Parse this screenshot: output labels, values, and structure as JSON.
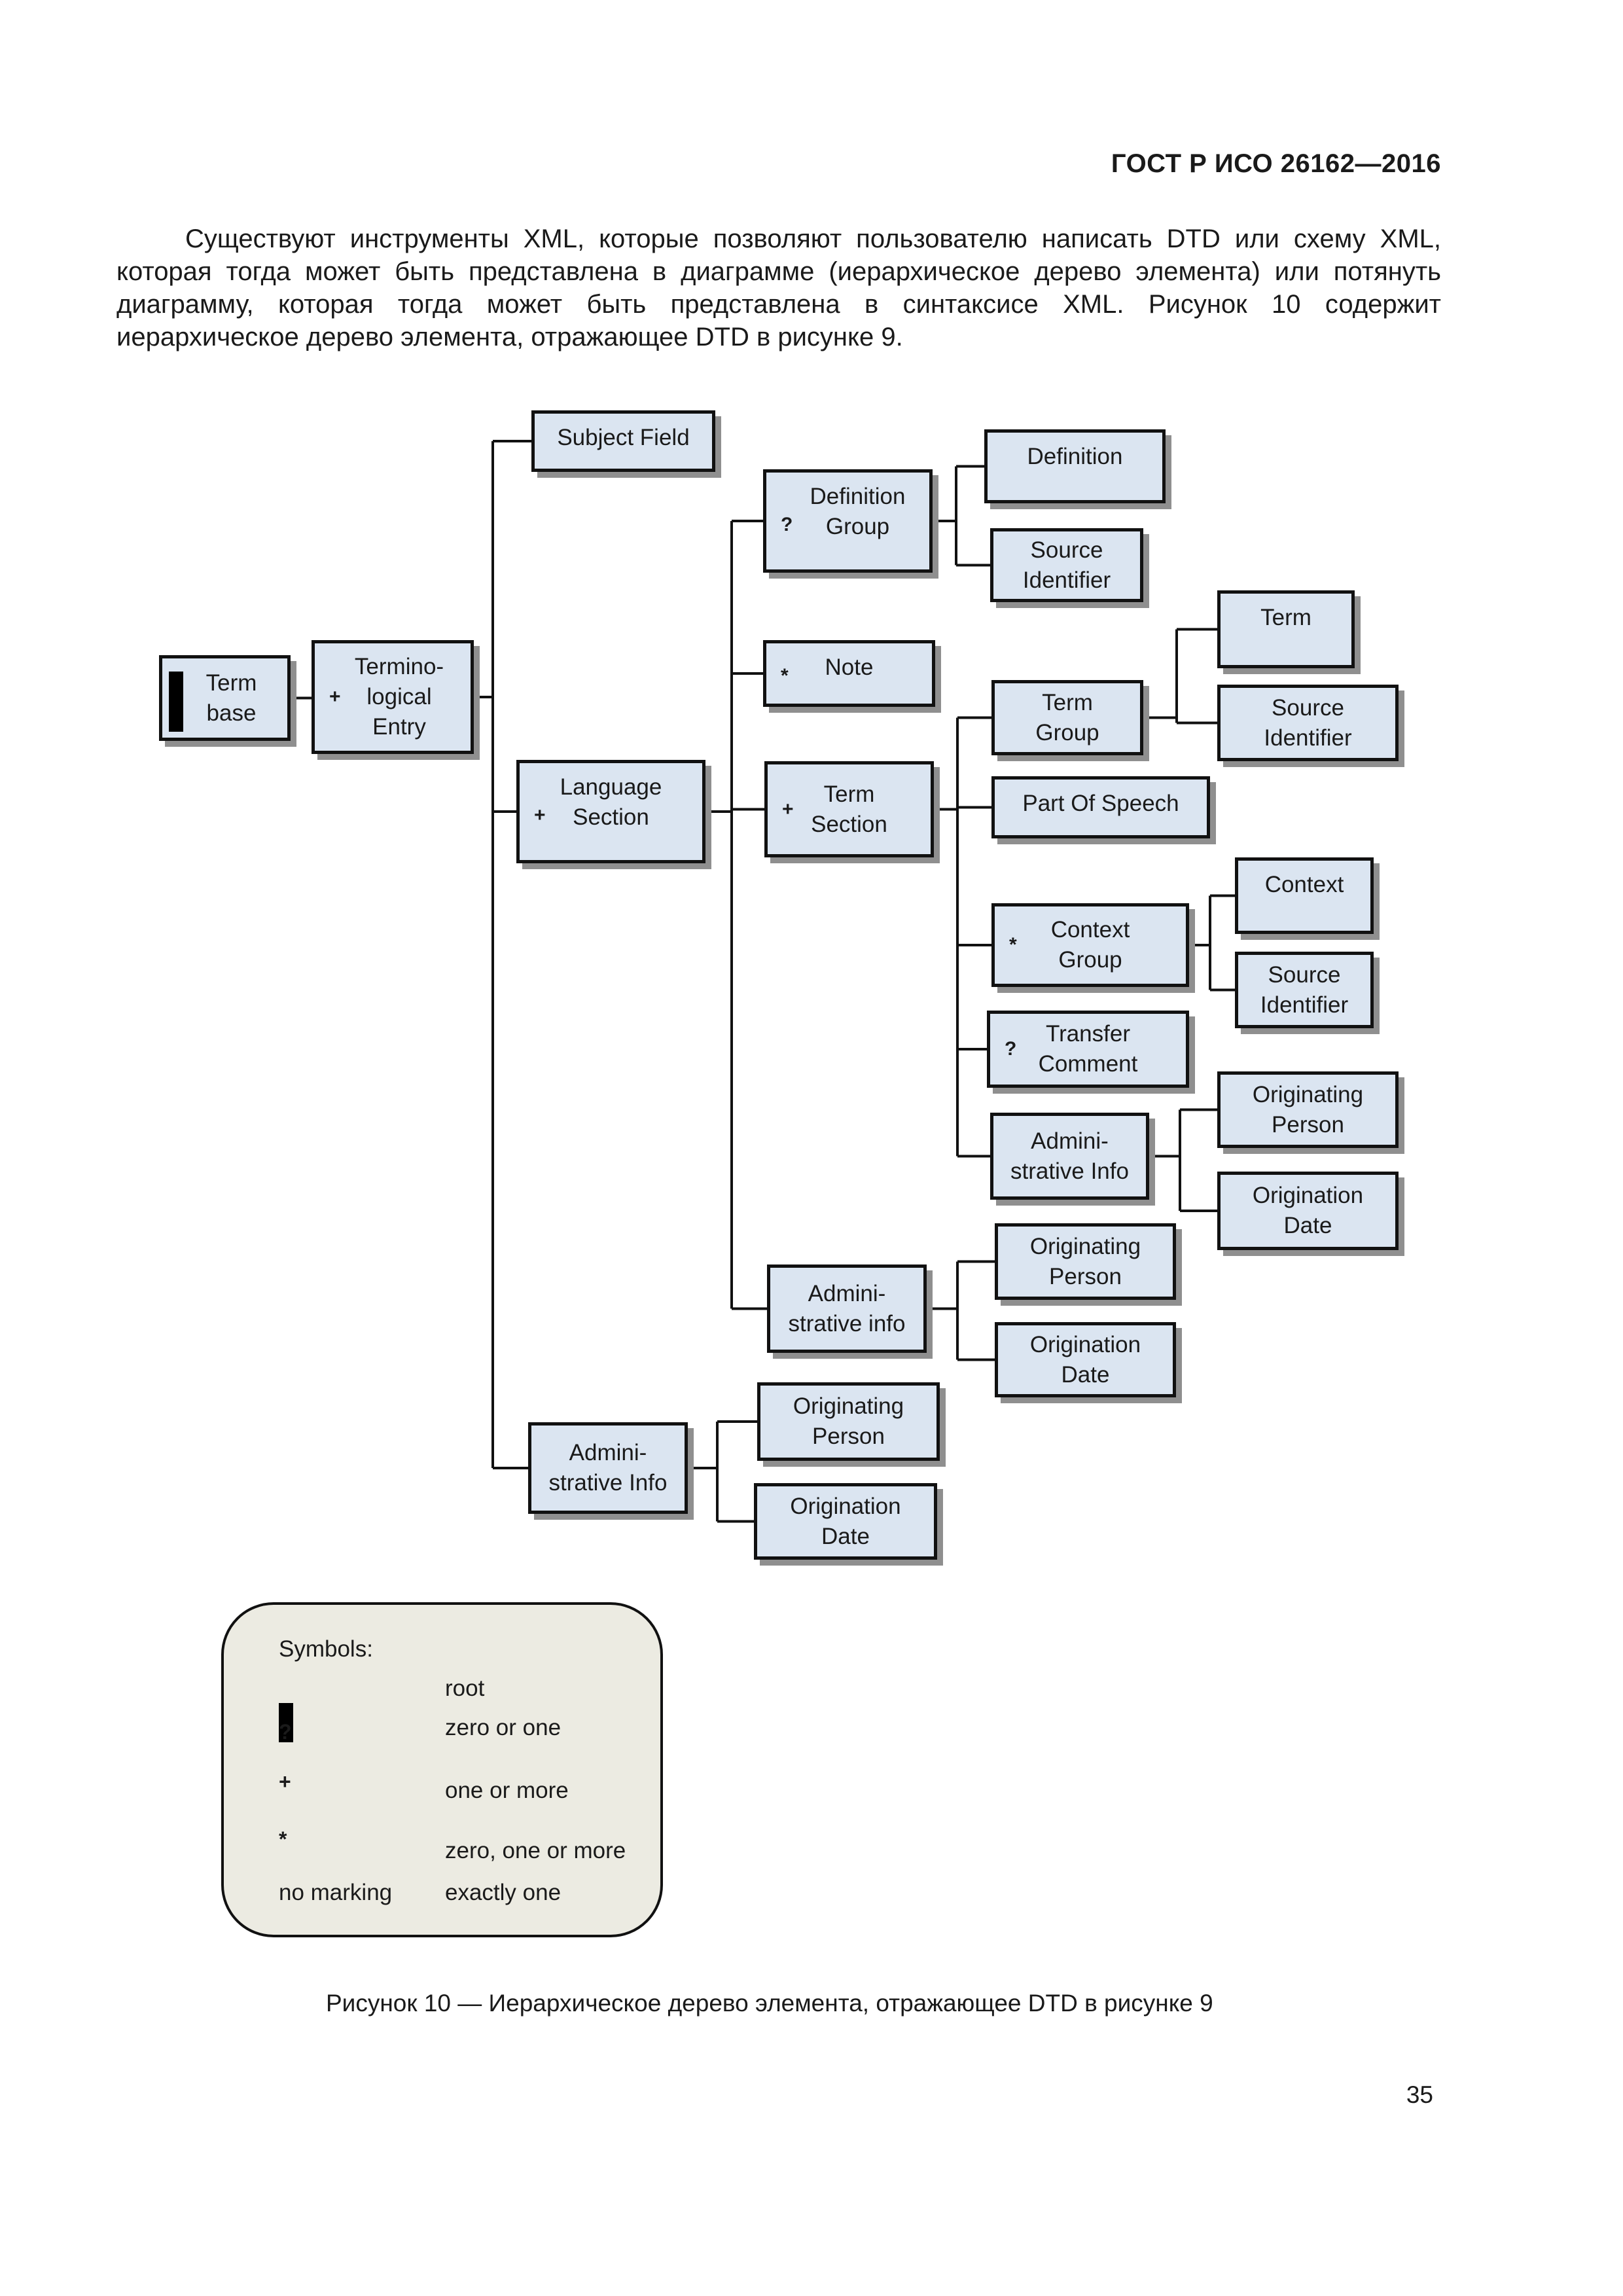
{
  "header": {
    "standard_id": "ГОСТ Р ИСО 26162—2016"
  },
  "intro_paragraph": "Существуют инструменты XML, которые позволяют пользователю написать DTD или схему XML, которая тогда может быть представлена в диаграмме (иерархическое дерево элемента) или потянуть диаграмму, которая тогда может быть представлена в синтаксисе XML. Рисунок 10 содержит иерархическое дерево элемента, отражающее DTD в рисунке 9.",
  "diagram": {
    "colors": {
      "box_fill": "#dbe5f1",
      "box_border": "#111111",
      "shadow": "#8f8f8f",
      "legend_fill": "#ecebe2"
    },
    "nodes": {
      "term_base": {
        "label": "Term\nbase",
        "marker": "root"
      },
      "terminological_entry": {
        "label": "Termino-\nlogical\nEntry",
        "marker": "+"
      },
      "subject_field": {
        "label": "Subject Field",
        "marker": ""
      },
      "language_section": {
        "label": "Language\nSection",
        "marker": "+"
      },
      "admin_info_entry": {
        "label": "Admini-\nstrative Info",
        "marker": ""
      },
      "definition_group": {
        "label": "Definition\nGroup",
        "marker": "?"
      },
      "note": {
        "label": "Note",
        "marker": "*"
      },
      "term_section": {
        "label": "Term\nSection",
        "marker": "+"
      },
      "admin_info_lang": {
        "label": "Admini-\nstrative info",
        "marker": ""
      },
      "definition": {
        "label": "Definition",
        "marker": ""
      },
      "source_identifier_def": {
        "label": "Source\nIdentifier",
        "marker": ""
      },
      "term_group": {
        "label": "Term\nGroup",
        "marker": ""
      },
      "part_of_speech": {
        "label": "Part Of Speech",
        "marker": ""
      },
      "context_group": {
        "label": "Context\nGroup",
        "marker": "*"
      },
      "transfer_comment": {
        "label": "Transfer\nComment",
        "marker": "?"
      },
      "admin_info_term": {
        "label": "Admini-\nstrative Info",
        "marker": ""
      },
      "term": {
        "label": "Term",
        "marker": ""
      },
      "source_identifier_term": {
        "label": "Source\nIdentifier",
        "marker": ""
      },
      "context": {
        "label": "Context",
        "marker": ""
      },
      "source_identifier_context": {
        "label": "Source\nIdentifier",
        "marker": ""
      },
      "originating_person_term": {
        "label": "Originating\nPerson",
        "marker": ""
      },
      "origination_date_term": {
        "label": "Origination\nDate",
        "marker": ""
      },
      "originating_person_lang": {
        "label": "Originating\nPerson",
        "marker": ""
      },
      "origination_date_lang": {
        "label": "Origination\nDate",
        "marker": ""
      },
      "originating_person_entry": {
        "label": "Originating\nPerson",
        "marker": ""
      },
      "origination_date_entry": {
        "label": "Origination\nDate",
        "marker": ""
      }
    },
    "edges": [
      [
        "term_base",
        "terminological_entry"
      ],
      [
        "terminological_entry",
        "subject_field"
      ],
      [
        "terminological_entry",
        "language_section"
      ],
      [
        "terminological_entry",
        "admin_info_entry"
      ],
      [
        "language_section",
        "definition_group"
      ],
      [
        "language_section",
        "note"
      ],
      [
        "language_section",
        "term_section"
      ],
      [
        "language_section",
        "admin_info_lang"
      ],
      [
        "definition_group",
        "definition"
      ],
      [
        "definition_group",
        "source_identifier_def"
      ],
      [
        "term_section",
        "term_group"
      ],
      [
        "term_section",
        "part_of_speech"
      ],
      [
        "term_section",
        "context_group"
      ],
      [
        "term_section",
        "transfer_comment"
      ],
      [
        "term_section",
        "admin_info_term"
      ],
      [
        "term_group",
        "term"
      ],
      [
        "term_group",
        "source_identifier_term"
      ],
      [
        "context_group",
        "context"
      ],
      [
        "context_group",
        "source_identifier_context"
      ],
      [
        "admin_info_term",
        "originating_person_term"
      ],
      [
        "admin_info_term",
        "origination_date_term"
      ],
      [
        "admin_info_lang",
        "originating_person_lang"
      ],
      [
        "admin_info_lang",
        "origination_date_lang"
      ],
      [
        "admin_info_entry",
        "originating_person_entry"
      ],
      [
        "admin_info_entry",
        "origination_date_entry"
      ]
    ]
  },
  "legend": {
    "title": "Symbols:",
    "items": [
      {
        "symbol": "root-bar",
        "description": "root"
      },
      {
        "symbol": "?",
        "description": "zero or one"
      },
      {
        "symbol": "+",
        "description": "one or more"
      },
      {
        "symbol": "*",
        "description": "zero, one or more"
      },
      {
        "symbol": "no marking",
        "description": "exactly one"
      }
    ]
  },
  "caption": "Рисунок 10 — Иерархическое дерево элемента, отражающее DTD в рисунке 9",
  "page_number": "35"
}
